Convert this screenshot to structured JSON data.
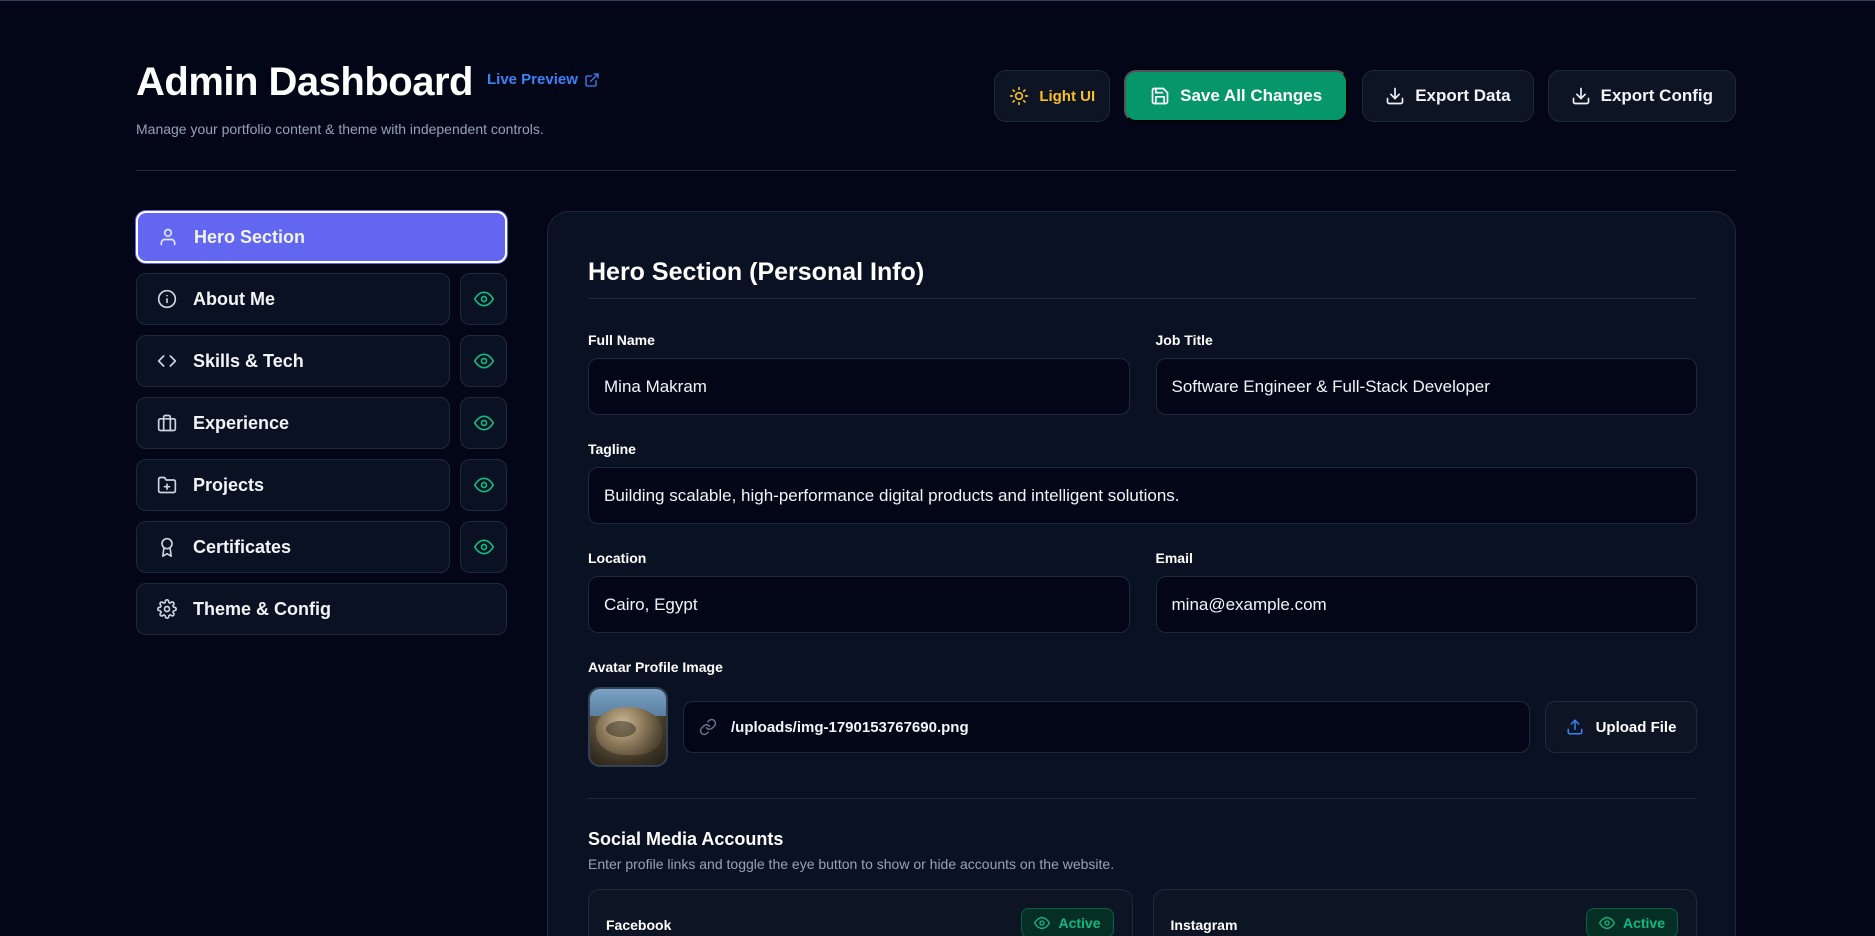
{
  "header": {
    "title": "Admin Dashboard",
    "live_preview": "Live Preview",
    "subtitle": "Manage your portfolio content & theme with independent controls.",
    "buttons": {
      "light_ui": "Light UI",
      "save": "Save All Changes",
      "export_data": "Export Data",
      "export_config": "Export Config"
    }
  },
  "sidebar": {
    "items": [
      {
        "label": "Hero Section",
        "icon": "user-icon",
        "active": true
      },
      {
        "label": "About Me",
        "icon": "info-icon",
        "visible": true
      },
      {
        "label": "Skills & Tech",
        "icon": "code-icon",
        "visible": true
      },
      {
        "label": "Experience",
        "icon": "briefcase-icon",
        "visible": true
      },
      {
        "label": "Projects",
        "icon": "folder-plus-icon",
        "visible": true
      },
      {
        "label": "Certificates",
        "icon": "award-icon",
        "visible": true
      },
      {
        "label": "Theme & Config",
        "icon": "gear-icon"
      }
    ]
  },
  "hero": {
    "title": "Hero Section (Personal Info)",
    "full_name": {
      "label": "Full Name",
      "value": "Mina Makram"
    },
    "job_title": {
      "label": "Job Title",
      "value": "Software Engineer & Full-Stack Developer"
    },
    "tagline": {
      "label": "Tagline",
      "value": "Building scalable, high-performance digital products and intelligent solutions."
    },
    "location": {
      "label": "Location",
      "value": "Cairo, Egypt"
    },
    "email": {
      "label": "Email",
      "value": "mina@example.com"
    },
    "avatar": {
      "label": "Avatar Profile Image",
      "url": "/uploads/img-1790153767690.png",
      "upload_label": "Upload File"
    }
  },
  "social": {
    "title": "Social Media Accounts",
    "description": "Enter profile links and toggle the eye button to show or hide accounts on the website.",
    "accounts": [
      {
        "name": "Facebook",
        "status": "Active"
      },
      {
        "name": "Instagram",
        "status": "Active"
      }
    ]
  },
  "colors": {
    "background": "#030617",
    "panel": "#0a1122",
    "accent": "#6366f1",
    "save": "#059669",
    "success": "#10b981",
    "link": "#3b82f6",
    "warning": "#fbbf24"
  }
}
